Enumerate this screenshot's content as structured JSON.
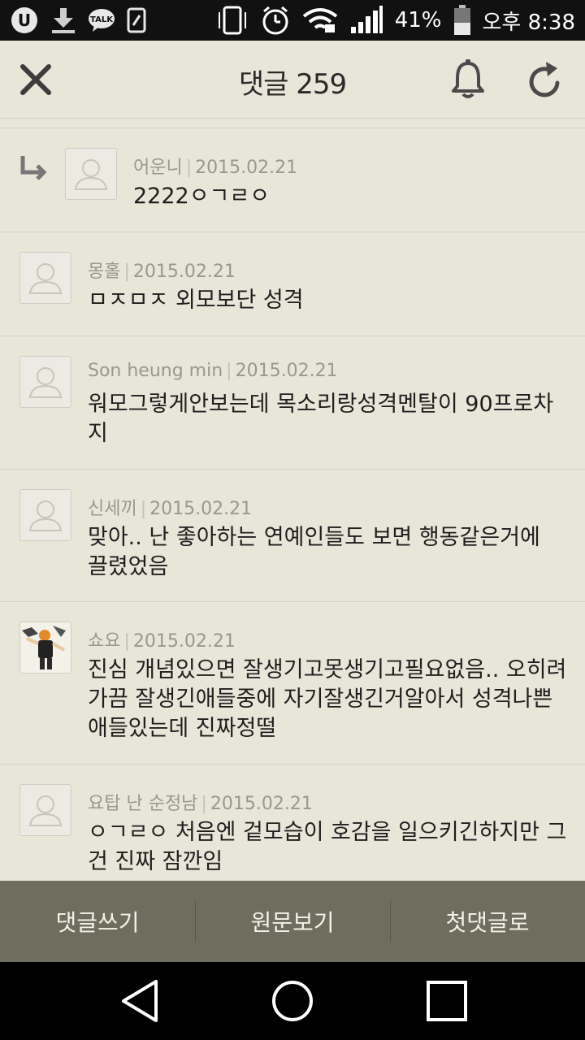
{
  "status_bar": {
    "battery": "41%",
    "time": "오후 8:38",
    "icons": [
      "u-plus-icon",
      "download-icon",
      "kakaotalk-icon",
      "sim-icon",
      "vibrate-icon",
      "alarm-icon",
      "wifi-icon",
      "signal-icon",
      "battery-icon"
    ]
  },
  "header": {
    "title": "댓글 259",
    "icons": [
      "close-icon",
      "bell-icon",
      "refresh-icon"
    ]
  },
  "comments": [
    {
      "author": "어운니",
      "date": "2015.02.21",
      "text": "2222ㅇㄱㄹㅇ",
      "is_reply": true
    },
    {
      "author": "몽홀",
      "date": "2015.02.21",
      "text": "ㅁㅈㅁㅈ 외모보단 성격",
      "is_reply": false
    },
    {
      "author": "Son heung min",
      "date": "2015.02.21",
      "text": "워모그렇게안보는데 목소리랑성격멘탈이 90프로차지",
      "is_reply": false
    },
    {
      "author": "신세끼",
      "date": "2015.02.21",
      "text": "맞아.. 난 좋아하는 연예인들도 보면 행동같은거에 끌렸었음",
      "is_reply": false
    },
    {
      "author": "쇼요",
      "date": "2015.02.21",
      "text": "진심 개념있으면 잘생기고못생기고필요없음.. 오히려가끔 잘생긴애들중에 자기잘생긴거알아서 성격나쁜애들있는데 진짜정떨",
      "is_reply": false,
      "avatar": "photo"
    },
    {
      "author": "요탑 난 순정남",
      "date": "2015.02.21",
      "text": "ㅇㄱㄹㅇ 처음엔 겉모습이 호감을 일으키긴하지만 그건 진짜 잠깐임",
      "is_reply": false
    }
  ],
  "action_bar": {
    "write": "댓글쓰기",
    "original": "원문보기",
    "first": "첫댓글로"
  },
  "nav_bar": {
    "icons": [
      "back-icon",
      "home-icon",
      "recents-icon"
    ]
  }
}
